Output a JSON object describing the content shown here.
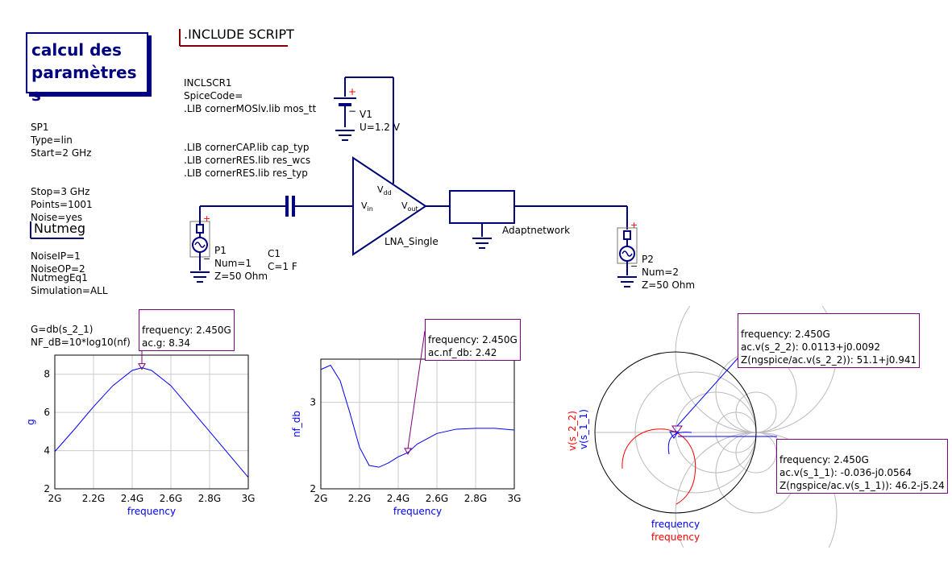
{
  "sp_title": [
    "calcul des",
    "paramètres s"
  ],
  "sp_params": [
    "SP1",
    "Type=lin",
    "Start=2 GHz",
    "Stop=3 GHz",
    "Points=1001",
    "Noise=yes",
    "NoiseIP=1",
    "NoiseOP=2"
  ],
  "include_header": ".INCLUDE SCRIPT",
  "include_lines": [
    "INCLSCR1",
    "SpiceCode=",
    ".LIB cornerMOSlv.lib mos_tt",
    ".LIB cornerCAP.lib cap_typ",
    ".LIB cornerRES.lib res_wcs",
    ".LIB cornerRES.lib res_typ"
  ],
  "nutmeg_header": "Nutmeg",
  "nutmeg_lines": [
    "NutmegEq1",
    "Simulation=ALL",
    "G=db(s_2_1)",
    "NF_dB=10*log10(nf)"
  ],
  "v1": {
    "name": "V1",
    "value": "U=1.2 V"
  },
  "p1": {
    "name": "P1",
    "num": "Num=1",
    "z": "Z=50 Ohm"
  },
  "c1": {
    "name": "C1",
    "value": "C=1 F"
  },
  "p2": {
    "name": "P2",
    "num": "Num=2",
    "z": "Z=50 Ohm"
  },
  "lna": {
    "name": "LNA_Single",
    "vdd": "V",
    "vdd_sub": "dd",
    "vin": "V",
    "vin_sub": "in",
    "vout": "V",
    "vout_sub": "out"
  },
  "adapt": "Adaptnetwork",
  "graph_g": {
    "marker": [
      "frequency: 2.450G",
      "ac.g: 8.34"
    ],
    "ylabel": "g",
    "xlabel": "frequency",
    "xticks": [
      "2G",
      "2.2G",
      "2.4G",
      "2.6G",
      "2.8G",
      "3G"
    ],
    "yticks": [
      "2",
      "4",
      "6",
      "8"
    ]
  },
  "graph_nf": {
    "marker": [
      "frequency: 2.450G",
      "ac.nf_db: 2.42"
    ],
    "ylabel": "nf_db",
    "xlabel": "frequency",
    "xticks": [
      "2G",
      "2.2G",
      "2.4G",
      "2.6G",
      "2.8G",
      "3G"
    ],
    "yticks": [
      "2",
      "3"
    ]
  },
  "smith": {
    "marker_top": [
      "frequency: 2.450G",
      "ac.v(s_2_2): 0.0113+j0.0092",
      "Z(ngspice/ac.v(s_2_2)): 51.1+j0.941"
    ],
    "marker_bottom": [
      "frequency: 2.450G",
      "ac.v(s_1_1): -0.036-j0.0564",
      "Z(ngspice/ac.v(s_1_1)): 46.2-j5.24"
    ],
    "ylabel_red": "v(s_2_2)",
    "ylabel_blue": "v(s_1_1)",
    "xlabel_blue": "frequency",
    "xlabel_red": "frequency"
  },
  "chart_data": [
    {
      "type": "line",
      "xlabel": "frequency",
      "ylabel": "g",
      "xlim": [
        2.0,
        3.0
      ],
      "ylim": [
        2,
        9
      ],
      "series": [
        {
          "color": "#0000ff",
          "x": [
            2.0,
            2.1,
            2.2,
            2.3,
            2.4,
            2.45,
            2.5,
            2.6,
            2.7,
            2.8,
            2.9,
            3.0
          ],
          "y": [
            3.95,
            5.1,
            6.3,
            7.4,
            8.2,
            8.34,
            8.2,
            7.4,
            6.2,
            5.0,
            3.8,
            2.6
          ]
        }
      ],
      "marker": {
        "x": 2.45,
        "y": 8.34
      }
    },
    {
      "type": "line",
      "xlabel": "frequency",
      "ylabel": "nf_db",
      "xlim": [
        2.0,
        3.0
      ],
      "ylim": [
        2,
        3.5
      ],
      "series": [
        {
          "color": "#0000ff",
          "x": [
            2.0,
            2.05,
            2.1,
            2.15,
            2.2,
            2.25,
            2.3,
            2.35,
            2.4,
            2.45,
            2.5,
            2.6,
            2.7,
            2.8,
            2.9,
            3.0
          ],
          "y": [
            3.38,
            3.43,
            3.25,
            2.88,
            2.48,
            2.27,
            2.25,
            2.3,
            2.37,
            2.42,
            2.52,
            2.64,
            2.69,
            2.7,
            2.7,
            2.68
          ]
        }
      ],
      "marker": {
        "x": 2.45,
        "y": 2.42
      }
    }
  ]
}
